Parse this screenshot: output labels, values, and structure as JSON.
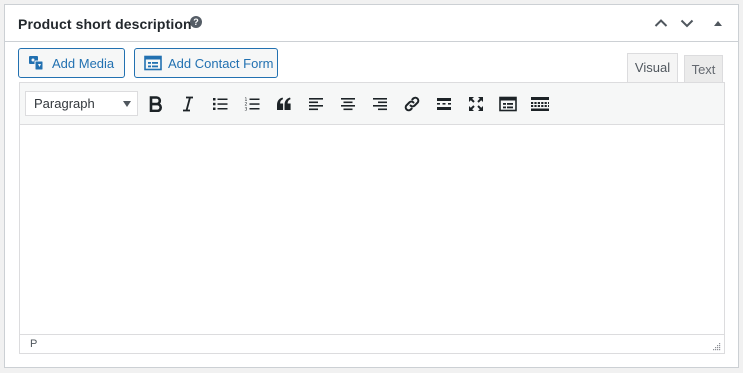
{
  "postbox": {
    "title": "Product short description",
    "help_glyph": "?",
    "controls": [
      "move-up-icon",
      "move-down-icon",
      "toggle-panel-icon"
    ]
  },
  "media_buttons": {
    "add_media_label": "Add Media",
    "add_contact_form_label": "Add Contact Form"
  },
  "tabs": {
    "visual_label": "Visual",
    "text_label": "Text",
    "active": "visual"
  },
  "toolbar": {
    "format_select_value": "Paragraph",
    "buttons": [
      "bold-icon",
      "italic-icon",
      "bulleted-list-icon",
      "numbered-list-icon",
      "blockquote-icon",
      "align-left-icon",
      "align-center-icon",
      "align-right-icon",
      "insert-link-icon",
      "read-more-icon",
      "fullscreen-icon",
      "insert-form-icon",
      "toolbar-toggle-icon"
    ]
  },
  "editor": {
    "content": ""
  },
  "statusbar": {
    "path": "P"
  },
  "colors": {
    "accent": "#2271b1",
    "icon": "#1d2327",
    "border": "#dcdcde",
    "background": "#f1f1f1"
  }
}
